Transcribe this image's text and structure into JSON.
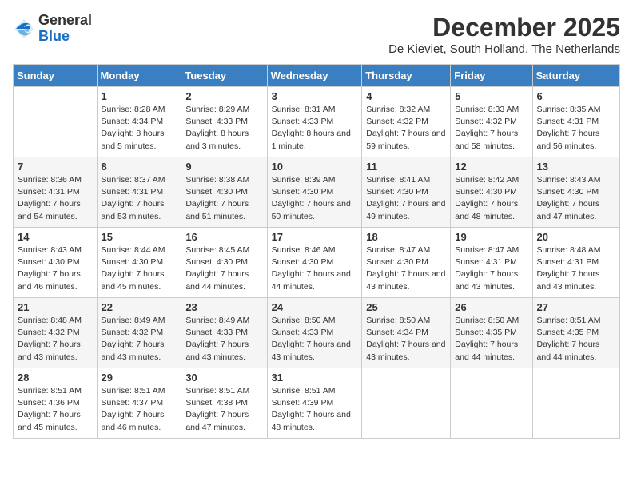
{
  "header": {
    "logo": {
      "line1": "General",
      "line2": "Blue"
    },
    "title": "December 2025",
    "location": "De Kieviet, South Holland, The Netherlands"
  },
  "days_of_week": [
    "Sunday",
    "Monday",
    "Tuesday",
    "Wednesday",
    "Thursday",
    "Friday",
    "Saturday"
  ],
  "weeks": [
    [
      {
        "day": "",
        "sunrise": "",
        "sunset": "",
        "daylight": ""
      },
      {
        "day": "1",
        "sunrise": "Sunrise: 8:28 AM",
        "sunset": "Sunset: 4:34 PM",
        "daylight": "Daylight: 8 hours and 5 minutes."
      },
      {
        "day": "2",
        "sunrise": "Sunrise: 8:29 AM",
        "sunset": "Sunset: 4:33 PM",
        "daylight": "Daylight: 8 hours and 3 minutes."
      },
      {
        "day": "3",
        "sunrise": "Sunrise: 8:31 AM",
        "sunset": "Sunset: 4:33 PM",
        "daylight": "Daylight: 8 hours and 1 minute."
      },
      {
        "day": "4",
        "sunrise": "Sunrise: 8:32 AM",
        "sunset": "Sunset: 4:32 PM",
        "daylight": "Daylight: 7 hours and 59 minutes."
      },
      {
        "day": "5",
        "sunrise": "Sunrise: 8:33 AM",
        "sunset": "Sunset: 4:32 PM",
        "daylight": "Daylight: 7 hours and 58 minutes."
      },
      {
        "day": "6",
        "sunrise": "Sunrise: 8:35 AM",
        "sunset": "Sunset: 4:31 PM",
        "daylight": "Daylight: 7 hours and 56 minutes."
      }
    ],
    [
      {
        "day": "7",
        "sunrise": "Sunrise: 8:36 AM",
        "sunset": "Sunset: 4:31 PM",
        "daylight": "Daylight: 7 hours and 54 minutes."
      },
      {
        "day": "8",
        "sunrise": "Sunrise: 8:37 AM",
        "sunset": "Sunset: 4:31 PM",
        "daylight": "Daylight: 7 hours and 53 minutes."
      },
      {
        "day": "9",
        "sunrise": "Sunrise: 8:38 AM",
        "sunset": "Sunset: 4:30 PM",
        "daylight": "Daylight: 7 hours and 51 minutes."
      },
      {
        "day": "10",
        "sunrise": "Sunrise: 8:39 AM",
        "sunset": "Sunset: 4:30 PM",
        "daylight": "Daylight: 7 hours and 50 minutes."
      },
      {
        "day": "11",
        "sunrise": "Sunrise: 8:41 AM",
        "sunset": "Sunset: 4:30 PM",
        "daylight": "Daylight: 7 hours and 49 minutes."
      },
      {
        "day": "12",
        "sunrise": "Sunrise: 8:42 AM",
        "sunset": "Sunset: 4:30 PM",
        "daylight": "Daylight: 7 hours and 48 minutes."
      },
      {
        "day": "13",
        "sunrise": "Sunrise: 8:43 AM",
        "sunset": "Sunset: 4:30 PM",
        "daylight": "Daylight: 7 hours and 47 minutes."
      }
    ],
    [
      {
        "day": "14",
        "sunrise": "Sunrise: 8:43 AM",
        "sunset": "Sunset: 4:30 PM",
        "daylight": "Daylight: 7 hours and 46 minutes."
      },
      {
        "day": "15",
        "sunrise": "Sunrise: 8:44 AM",
        "sunset": "Sunset: 4:30 PM",
        "daylight": "Daylight: 7 hours and 45 minutes."
      },
      {
        "day": "16",
        "sunrise": "Sunrise: 8:45 AM",
        "sunset": "Sunset: 4:30 PM",
        "daylight": "Daylight: 7 hours and 44 minutes."
      },
      {
        "day": "17",
        "sunrise": "Sunrise: 8:46 AM",
        "sunset": "Sunset: 4:30 PM",
        "daylight": "Daylight: 7 hours and 44 minutes."
      },
      {
        "day": "18",
        "sunrise": "Sunrise: 8:47 AM",
        "sunset": "Sunset: 4:30 PM",
        "daylight": "Daylight: 7 hours and 43 minutes."
      },
      {
        "day": "19",
        "sunrise": "Sunrise: 8:47 AM",
        "sunset": "Sunset: 4:31 PM",
        "daylight": "Daylight: 7 hours and 43 minutes."
      },
      {
        "day": "20",
        "sunrise": "Sunrise: 8:48 AM",
        "sunset": "Sunset: 4:31 PM",
        "daylight": "Daylight: 7 hours and 43 minutes."
      }
    ],
    [
      {
        "day": "21",
        "sunrise": "Sunrise: 8:48 AM",
        "sunset": "Sunset: 4:32 PM",
        "daylight": "Daylight: 7 hours and 43 minutes."
      },
      {
        "day": "22",
        "sunrise": "Sunrise: 8:49 AM",
        "sunset": "Sunset: 4:32 PM",
        "daylight": "Daylight: 7 hours and 43 minutes."
      },
      {
        "day": "23",
        "sunrise": "Sunrise: 8:49 AM",
        "sunset": "Sunset: 4:33 PM",
        "daylight": "Daylight: 7 hours and 43 minutes."
      },
      {
        "day": "24",
        "sunrise": "Sunrise: 8:50 AM",
        "sunset": "Sunset: 4:33 PM",
        "daylight": "Daylight: 7 hours and 43 minutes."
      },
      {
        "day": "25",
        "sunrise": "Sunrise: 8:50 AM",
        "sunset": "Sunset: 4:34 PM",
        "daylight": "Daylight: 7 hours and 43 minutes."
      },
      {
        "day": "26",
        "sunrise": "Sunrise: 8:50 AM",
        "sunset": "Sunset: 4:35 PM",
        "daylight": "Daylight: 7 hours and 44 minutes."
      },
      {
        "day": "27",
        "sunrise": "Sunrise: 8:51 AM",
        "sunset": "Sunset: 4:35 PM",
        "daylight": "Daylight: 7 hours and 44 minutes."
      }
    ],
    [
      {
        "day": "28",
        "sunrise": "Sunrise: 8:51 AM",
        "sunset": "Sunset: 4:36 PM",
        "daylight": "Daylight: 7 hours and 45 minutes."
      },
      {
        "day": "29",
        "sunrise": "Sunrise: 8:51 AM",
        "sunset": "Sunset: 4:37 PM",
        "daylight": "Daylight: 7 hours and 46 minutes."
      },
      {
        "day": "30",
        "sunrise": "Sunrise: 8:51 AM",
        "sunset": "Sunset: 4:38 PM",
        "daylight": "Daylight: 7 hours and 47 minutes."
      },
      {
        "day": "31",
        "sunrise": "Sunrise: 8:51 AM",
        "sunset": "Sunset: 4:39 PM",
        "daylight": "Daylight: 7 hours and 48 minutes."
      },
      {
        "day": "",
        "sunrise": "",
        "sunset": "",
        "daylight": ""
      },
      {
        "day": "",
        "sunrise": "",
        "sunset": "",
        "daylight": ""
      },
      {
        "day": "",
        "sunrise": "",
        "sunset": "",
        "daylight": ""
      }
    ]
  ]
}
